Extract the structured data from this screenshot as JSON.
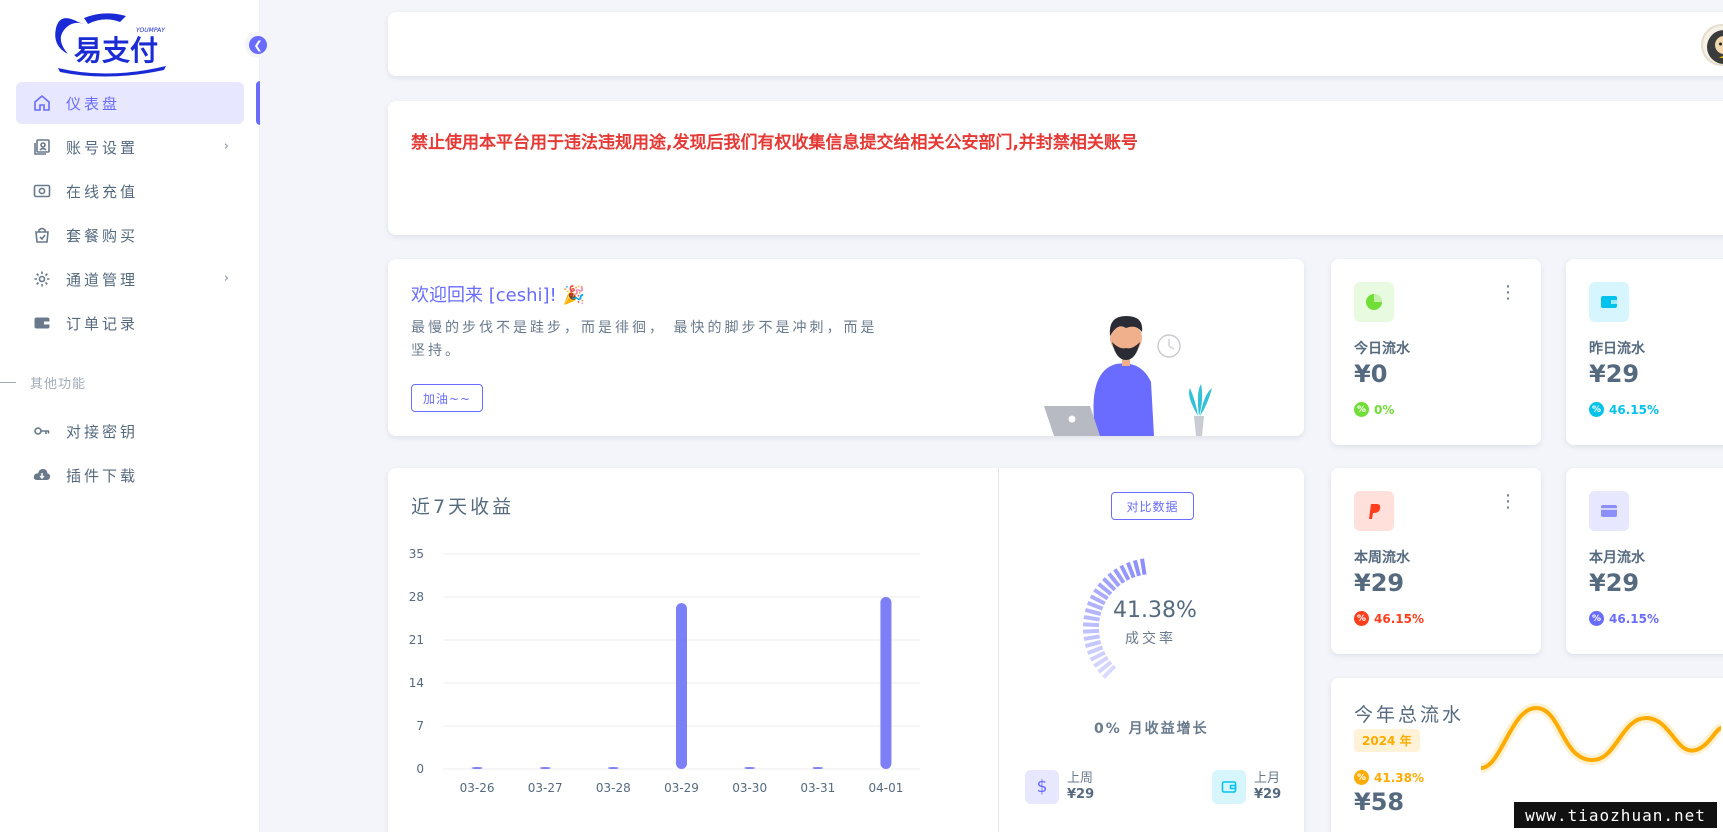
{
  "brand": {
    "name": "易支付",
    "tagline": "YOUMPAY",
    "accent": "#696cff"
  },
  "sidebar": {
    "items": [
      {
        "label": "仪表盘",
        "icon": "home-icon",
        "active": true
      },
      {
        "label": "账号设置",
        "icon": "user-card-icon",
        "has_submenu": true
      },
      {
        "label": "在线充值",
        "icon": "money-icon"
      },
      {
        "label": "套餐购买",
        "icon": "shopping-bag-icon"
      },
      {
        "label": "通道管理",
        "icon": "gear-icon",
        "has_submenu": true
      },
      {
        "label": "订单记录",
        "icon": "wallet-icon"
      }
    ],
    "section_header": "其他功能",
    "extra_items": [
      {
        "label": "对接密钥",
        "icon": "key-icon"
      },
      {
        "label": "插件下载",
        "icon": "cloud-download-icon"
      }
    ]
  },
  "notice": {
    "text": "禁止使用本平台用于违法违规用途,发现后我们有权收集信息提交给相关公安部门,并封禁相关账号",
    "color": "#e53935"
  },
  "welcome": {
    "title": "欢迎回来 [ceshi]! 🎉",
    "desc": "最慢的步伐不是跬步，而是徘徊， 最快的脚步不是冲刺，而是坚持。",
    "button": "加油~~"
  },
  "stats": [
    {
      "title": "今日流水",
      "value": "¥0",
      "change": "0%",
      "icon": "pie-chart-icon",
      "color": "#71dd37",
      "bg": "#e8fadf"
    },
    {
      "title": "昨日流水",
      "value": "¥29",
      "change": "46.15%",
      "icon": "wallet-icon",
      "color": "#03c3ec",
      "bg": "#d7f5fc"
    },
    {
      "title": "本周流水",
      "value": "¥29",
      "change": "46.15%",
      "icon": "paypal-icon",
      "color": "#ff3e1d",
      "bg": "#ffe0db"
    },
    {
      "title": "本月流水",
      "value": "¥29",
      "change": "46.15%",
      "icon": "credit-card-icon",
      "color": "#696cff",
      "bg": "#e7e7ff"
    }
  ],
  "revenue": {
    "title": "近7天收益",
    "compare_button": "对比数据",
    "rate_value": "41.38%",
    "rate_label": "成交率",
    "rate": 41.38,
    "growth": "0% 月收益增长",
    "last_week": {
      "label": "上周",
      "value": "¥29"
    },
    "last_month": {
      "label": "上月",
      "value": "¥29"
    }
  },
  "chart_data": {
    "type": "bar",
    "categories": [
      "03-26",
      "03-27",
      "03-28",
      "03-29",
      "03-30",
      "03-31",
      "04-01"
    ],
    "values": [
      0,
      0,
      0,
      27,
      0,
      0,
      28
    ],
    "yticks": [
      0,
      7,
      14,
      21,
      28,
      35
    ],
    "ylim": [
      0,
      35
    ],
    "color": "#7c7ff5",
    "grid": true
  },
  "year": {
    "title": "今年总流水",
    "badge": "2024 年",
    "change": "41.38%",
    "value": "¥58",
    "color": "#ffab00"
  },
  "watermark": "www.tiaozhuan.net"
}
